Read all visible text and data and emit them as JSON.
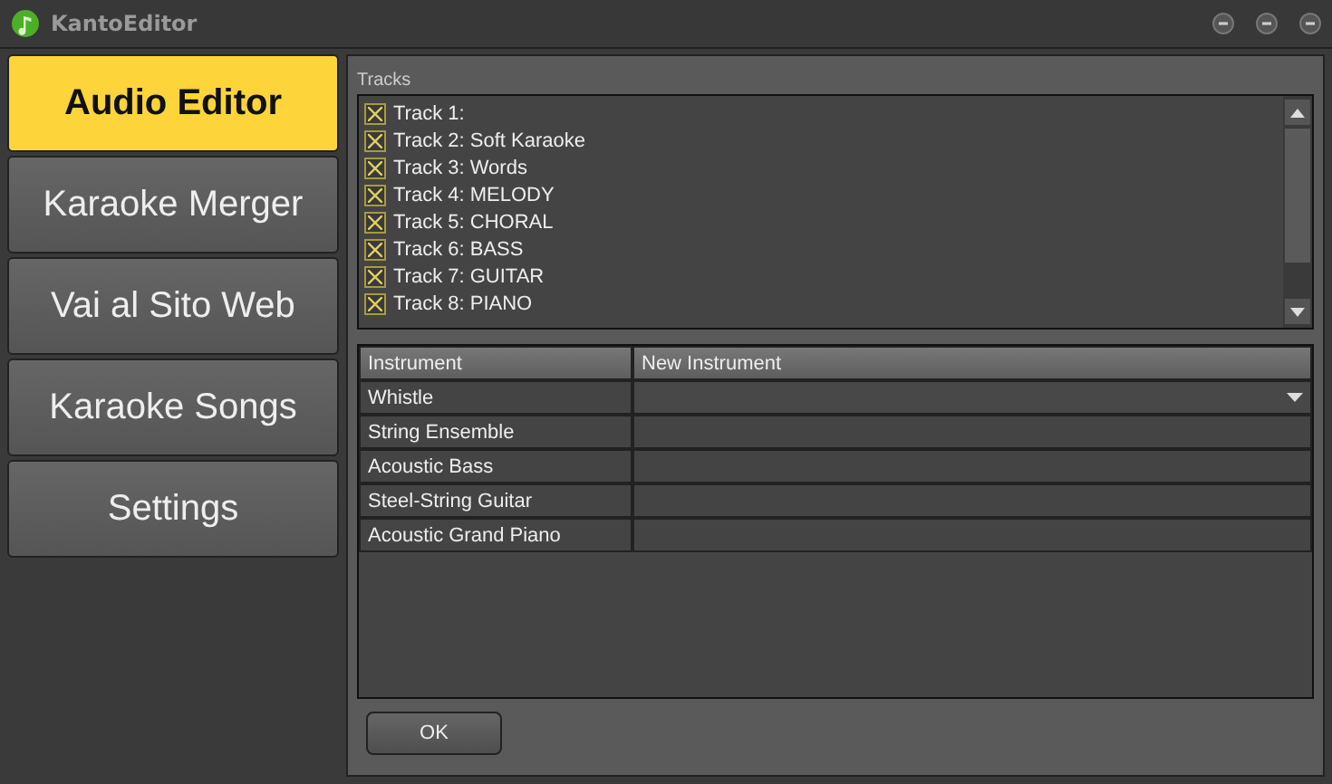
{
  "window": {
    "title": "KantoEditor"
  },
  "sidebar": {
    "items": [
      {
        "label": "Audio Editor",
        "selected": true
      },
      {
        "label": "Karaoke Merger",
        "selected": false
      },
      {
        "label": "Vai al Sito Web",
        "selected": false
      },
      {
        "label": "Karaoke Songs",
        "selected": false
      },
      {
        "label": "Settings",
        "selected": false
      }
    ]
  },
  "tracks": {
    "label": "Tracks",
    "items": [
      {
        "label": "Track 1:",
        "checked": true
      },
      {
        "label": "Track 2: Soft Karaoke",
        "checked": true
      },
      {
        "label": "Track 3: Words",
        "checked": true
      },
      {
        "label": "Track 4: MELODY",
        "checked": true
      },
      {
        "label": "Track 5: CHORAL",
        "checked": true
      },
      {
        "label": "Track 6: BASS",
        "checked": true
      },
      {
        "label": "Track 7: GUITAR",
        "checked": true
      },
      {
        "label": "Track 8: PIANO",
        "checked": true
      }
    ]
  },
  "table": {
    "columns": [
      "Instrument",
      "New Instrument"
    ],
    "rows": [
      {
        "instrument": "Whistle",
        "dropdown": true
      },
      {
        "instrument": "String Ensemble",
        "dropdown": false
      },
      {
        "instrument": "Acoustic Bass",
        "dropdown": false
      },
      {
        "instrument": "Steel-String Guitar",
        "dropdown": false
      },
      {
        "instrument": "Acoustic Grand Piano",
        "dropdown": false
      }
    ]
  },
  "buttons": [
    "OK"
  ]
}
